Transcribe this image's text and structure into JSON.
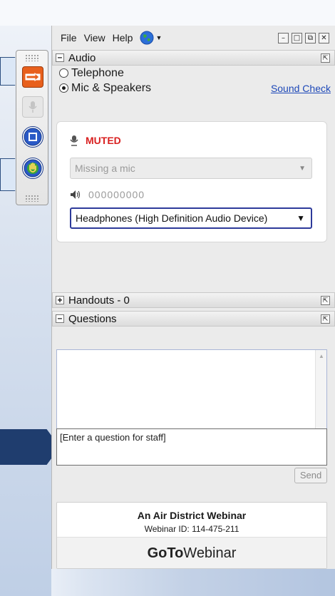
{
  "menu": {
    "file": "File",
    "view": "View",
    "help": "Help"
  },
  "audio": {
    "title": "Audio",
    "telephone": "Telephone",
    "mic_speakers": "Mic & Speakers",
    "selected": "Mic & Speakers",
    "sound_check": "Sound Check",
    "muted": "MUTED",
    "mic_select": "Missing a mic",
    "level_indicator": "000000000",
    "speaker_select": "Headphones (High Definition Audio Device)"
  },
  "handouts": {
    "title": "Handouts - 0"
  },
  "questions": {
    "title": "Questions",
    "placeholder": "[Enter a question for staff]",
    "send": "Send"
  },
  "footer": {
    "webinar_title": "An Air District Webinar",
    "webinar_id": "Webinar ID: 114-475-211",
    "brand_bold": "GoTo",
    "brand_rest": "Webinar"
  },
  "colors": {
    "muted": "#d92121",
    "link": "#1d48b8",
    "accent_orange": "#e8601c",
    "pointer_dark": "#1f3d6e"
  },
  "icons": [
    "arrow-right-icon",
    "microphone-icon",
    "stop-square-icon",
    "raise-hand-icon",
    "globe-icon",
    "speaker-icon"
  ]
}
